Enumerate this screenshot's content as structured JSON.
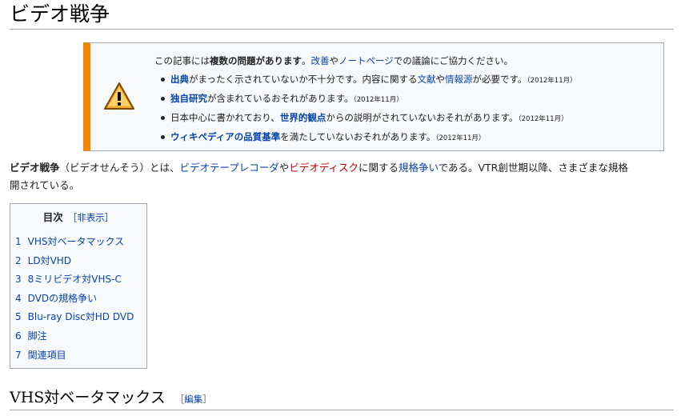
{
  "page": {
    "title": "ビデオ戦争"
  },
  "notice": {
    "lead_prefix": "この記事には",
    "lead_bold": "複数の問題があります",
    "lead_sep1": "。",
    "lead_link1": "改善",
    "lead_sep2": "や",
    "lead_link2": "ノートページ",
    "lead_suffix": "での議論にご協力ください。",
    "items": [
      {
        "link1": "出典",
        "text1": "がまったく示されていないか不十分です。内容に関する",
        "link2": "文献",
        "text2": "や",
        "link3": "情報源",
        "text3": "が必要です。",
        "date": "（2012年11月）"
      },
      {
        "link1": "独自研究",
        "text1": "が含まれているおそれがあります。",
        "date": "（2012年11月）"
      },
      {
        "text0": "日本中心に書かれており、",
        "link1": "世界的観点",
        "text1": "からの説明がされていないおそれがあります。",
        "date": "（2012年11月）"
      },
      {
        "link1": "ウィキペディアの品質基準",
        "text1": "を満たしていないおそれがあります。",
        "date": "（2012年11月）"
      }
    ]
  },
  "intro": {
    "bold": "ビデオ戦争",
    "t1": "（ビデオせんそう）とは、",
    "link1": "ビデオテープレコーダ",
    "t2": "や",
    "redlink": "ビデオディスク",
    "t3": "に関する",
    "link2": "規格争い",
    "t4": "である。VTR創世期以降、さまざまな規格",
    "line2": "開されている。"
  },
  "toc": {
    "title": "目次",
    "toggle": "［非表示］",
    "items": [
      {
        "num": "1",
        "label": "VHS対ベータマックス"
      },
      {
        "num": "2",
        "label": "LD対VHD"
      },
      {
        "num": "3",
        "label": "8ミリビデオ対VHS-C"
      },
      {
        "num": "4",
        "label": "DVDの規格争い"
      },
      {
        "num": "5",
        "label": "Blu-ray Disc対HD DVD"
      },
      {
        "num": "6",
        "label": "脚注"
      },
      {
        "num": "7",
        "label": "関連項目"
      }
    ]
  },
  "section1": {
    "heading": "VHS対ベータマックス",
    "edit_open": "［",
    "edit_label": "編集",
    "edit_close": "］"
  },
  "colors": {
    "notice_bar": "#f28500",
    "link": "#0645ad",
    "redlink": "#ba0000"
  }
}
